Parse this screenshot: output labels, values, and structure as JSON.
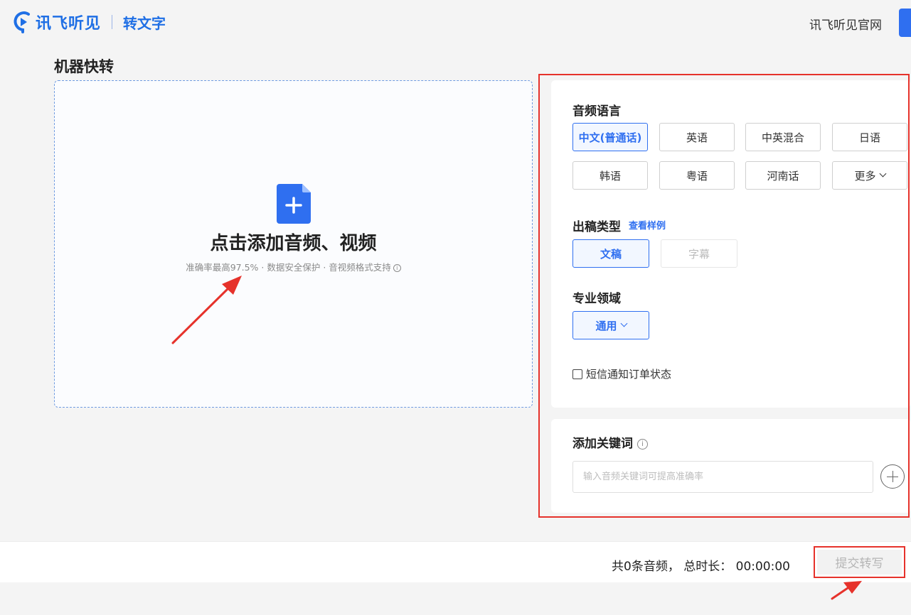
{
  "header": {
    "brand": "讯飞听见",
    "product": "转文字",
    "official_site": "讯飞听见官网"
  },
  "page": {
    "title": "机器快转"
  },
  "upload": {
    "title": "点击添加音频、视频",
    "subtitle": "准确率最高97.5% · 数据安全保护 · 音视频格式支持"
  },
  "settings": {
    "language": {
      "label": "音频语言",
      "options": [
        "中文(普通话)",
        "英语",
        "中英混合",
        "日语",
        "韩语",
        "粤语",
        "河南话",
        "更多"
      ],
      "selected": "中文(普通话)"
    },
    "output": {
      "label": "出稿类型",
      "sample_link": "查看样例",
      "options": [
        "文稿",
        "字幕"
      ],
      "selected": "文稿"
    },
    "domain": {
      "label": "专业领域",
      "value": "通用"
    },
    "sms_notify": {
      "label": "短信通知订单状态",
      "checked": false
    },
    "keywords": {
      "label": "添加关键词",
      "placeholder": "输入音频关键词可提高准确率"
    }
  },
  "footer": {
    "summary": "共0条音频，  总时长：  00:00:00",
    "submit_label": "提交转写"
  },
  "colors": {
    "accent": "#2f6ff0",
    "highlight": "#e6322b"
  }
}
